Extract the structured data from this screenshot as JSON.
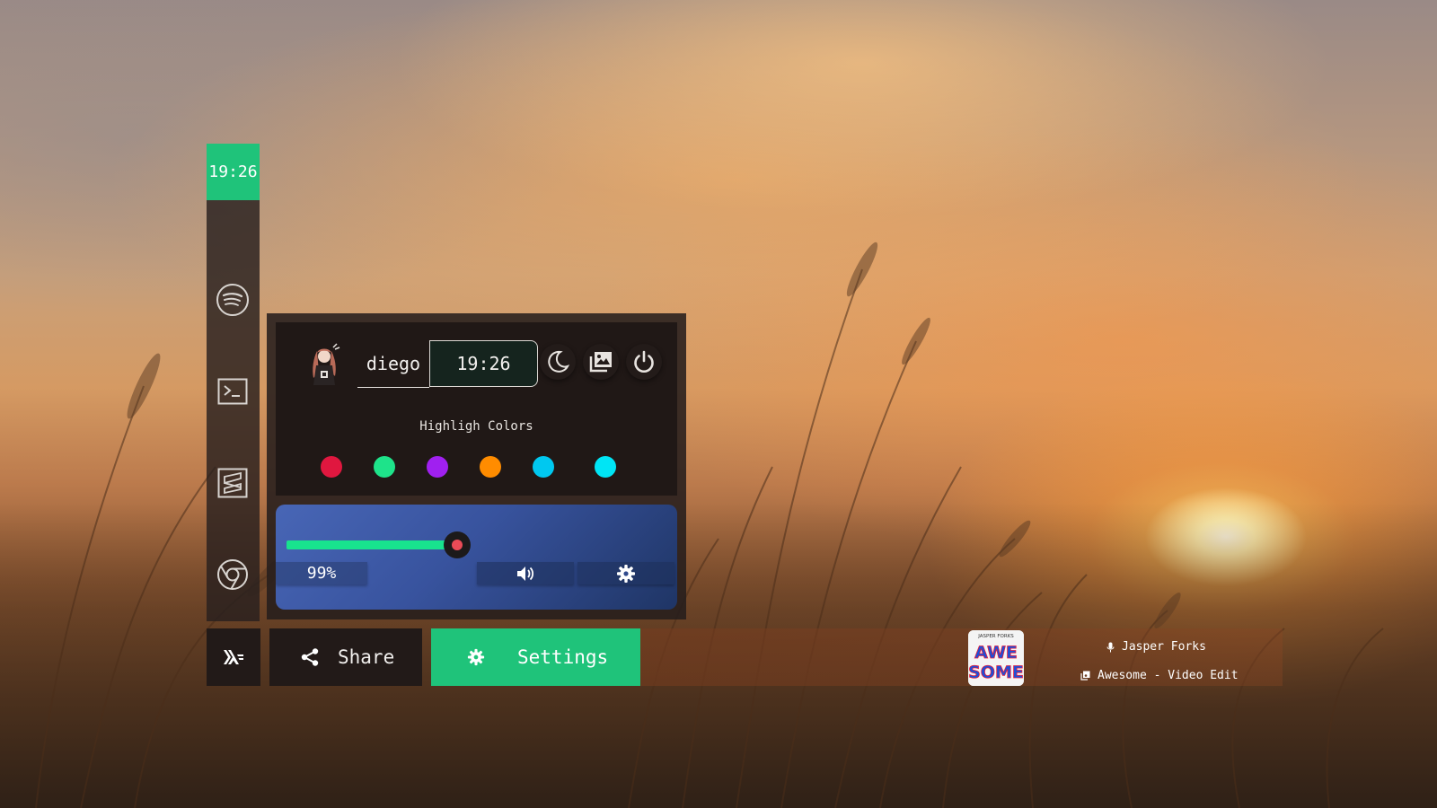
{
  "wallpaper": {
    "description_colors": [
      "#c9a07a",
      "#fff0b0"
    ]
  },
  "dock": {
    "clock": "19:26",
    "apps": [
      {
        "name": "spotify",
        "icon": "spotify-icon"
      },
      {
        "name": "terminal",
        "icon": "terminal-icon"
      },
      {
        "name": "sublime",
        "icon": "sublime-icon"
      },
      {
        "name": "chrome",
        "icon": "chrome-icon"
      }
    ]
  },
  "panel": {
    "username": "diego",
    "time": "19:26",
    "top_icons": [
      "moon-icon",
      "image-icon",
      "power-icon"
    ],
    "colors_title": "Highligh Colors",
    "colors": [
      "#e0173f",
      "#1ee38a",
      "#a020f0",
      "#ff8c00",
      "#00c8f0",
      "#00e5f5"
    ],
    "audio": {
      "volume_label": "99%",
      "slider_fill": 0.45,
      "buttons": [
        "volume-icon",
        "gear-icon"
      ]
    }
  },
  "bottom": {
    "share_label": "Share",
    "settings_label": "Settings",
    "accent": "#1fc37a",
    "now_playing": {
      "artist": "Jasper Forks",
      "track": "Awesome - Video Edit",
      "album_top_text": "JASPER FORKS",
      "album_title_lines": [
        "AWE",
        "SOME"
      ]
    }
  }
}
